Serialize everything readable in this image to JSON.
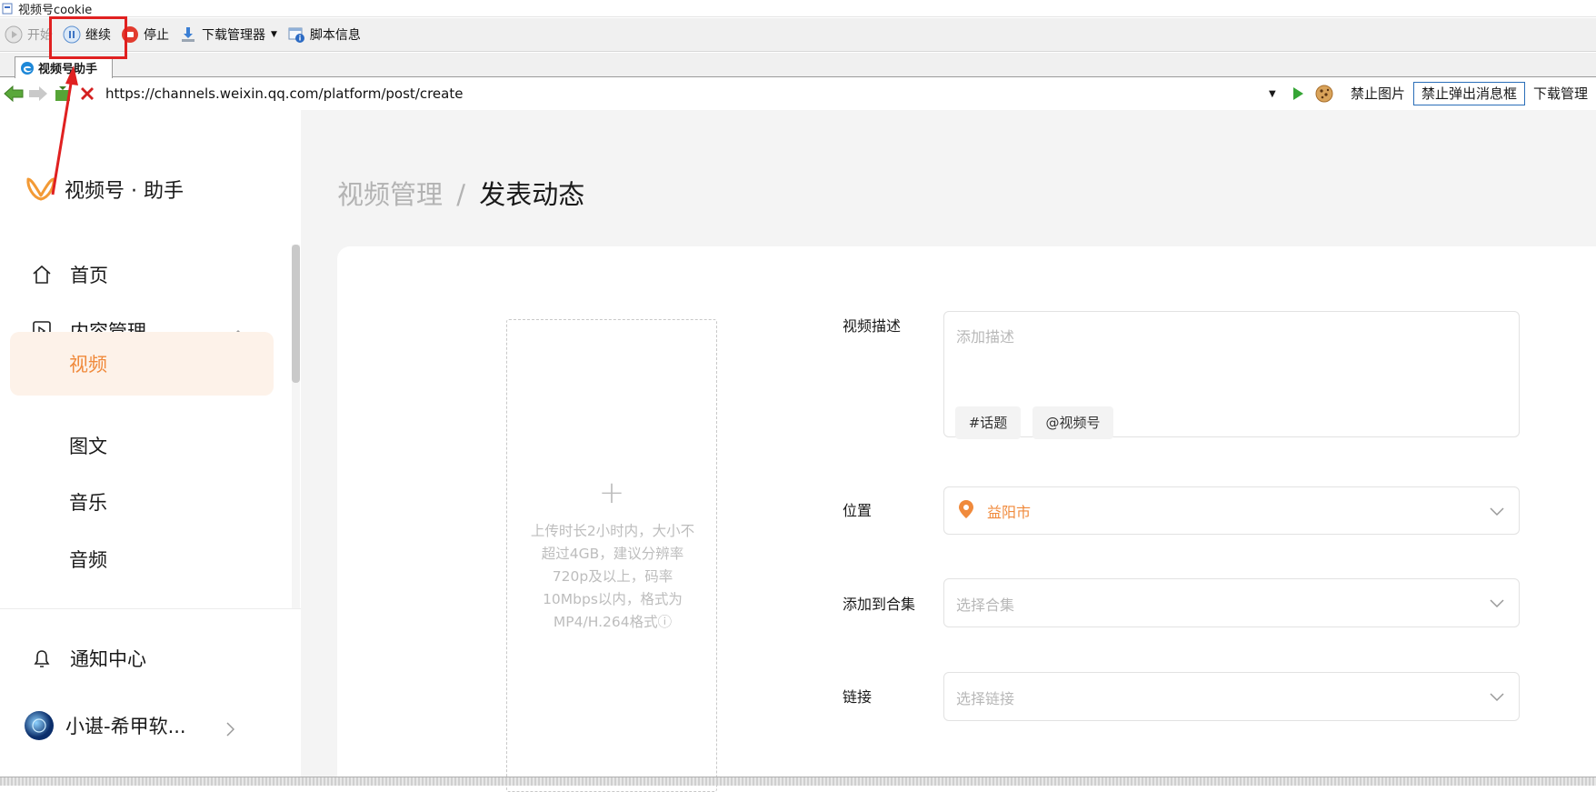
{
  "window": {
    "title": "视频号cookie"
  },
  "toolbar": {
    "start_label": "开始",
    "continue_label": "继续",
    "stop_label": "停止",
    "download_manager_label": "下载管理器",
    "script_info_label": "脚本信息"
  },
  "tab": {
    "label": "视频号助手"
  },
  "address": {
    "url": "https://channels.weixin.qq.com/platform/post/create",
    "block_images_label": "禁止图片",
    "block_popups_label": "禁止弹出消息框",
    "download_manage_label": "下载管理"
  },
  "sidebar": {
    "logo_text": "视频号 · 助手",
    "items": [
      {
        "label": "首页",
        "icon": "home-icon"
      },
      {
        "label": "内容管理",
        "icon": "play-square-icon"
      },
      {
        "label": "视频"
      },
      {
        "label": "图文"
      },
      {
        "label": "音乐"
      },
      {
        "label": "音频"
      }
    ],
    "notification_label": "通知中心",
    "account_name": "小谌-希甲软..."
  },
  "main": {
    "breadcrumb_parent": "视频管理",
    "breadcrumb_sep": "/",
    "breadcrumb_current": "发表动态",
    "upload": {
      "plus": "+",
      "hint": "上传时长2小时内，大小不超过4GB，建议分辨率720p及以上，码率10Mbps以内，格式为MP4/H.264格式ⓘ"
    },
    "form": {
      "description_label": "视频描述",
      "description_placeholder": "添加描述",
      "topic_tag": "#话题",
      "mention_tag": "@视频号",
      "location_label": "位置",
      "location_value": "益阳市",
      "collection_label": "添加到合集",
      "collection_placeholder": "选择合集",
      "link_label": "链接",
      "link_placeholder": "选择链接"
    }
  },
  "colors": {
    "accent": "#f08a3c",
    "active_bg": "#fdf2e9",
    "highlight_red": "#e02020"
  }
}
